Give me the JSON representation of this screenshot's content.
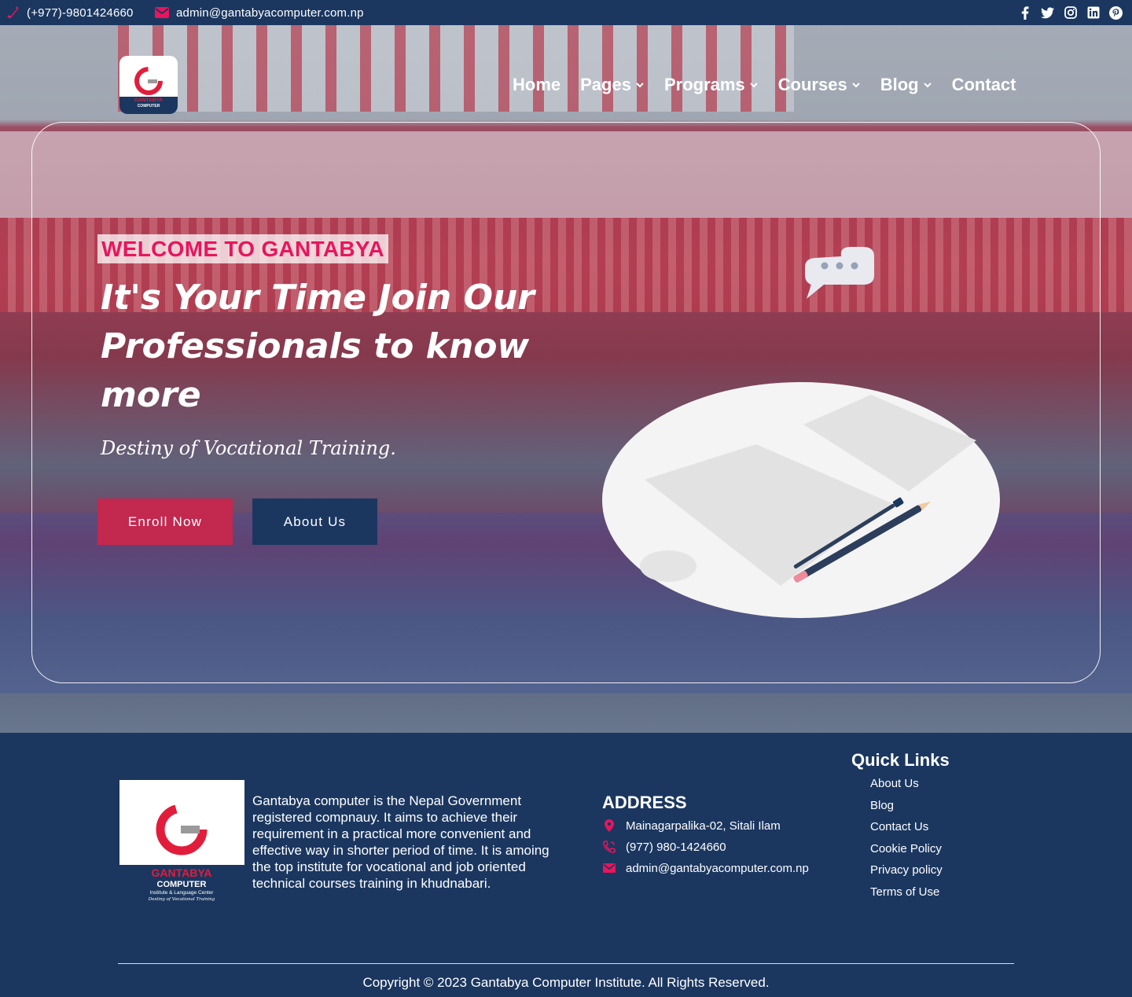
{
  "topbar": {
    "phone": "(+977)-9801424660",
    "email": "admin@gantabyacomputer.com.np",
    "social_icons": [
      "facebook-icon",
      "twitter-icon",
      "instagram-icon",
      "linkedin-icon",
      "pinterest-icon"
    ]
  },
  "brand": {
    "logo_title": "GANTABYA",
    "logo_subtitle": "COMPUTER",
    "logo_line": "Institute & Language Center",
    "logo_motto": "Destiny of Vocational Training"
  },
  "nav": {
    "items": [
      {
        "label": "Home",
        "has_dropdown": false
      },
      {
        "label": "Pages",
        "has_dropdown": true
      },
      {
        "label": "Programs",
        "has_dropdown": true
      },
      {
        "label": "Courses",
        "has_dropdown": true
      },
      {
        "label": "Blog",
        "has_dropdown": true
      },
      {
        "label": "Contact",
        "has_dropdown": false
      }
    ]
  },
  "hero": {
    "welcome": "WELCOME TO GANTABYA",
    "headline": "It's Your Time Join Our Professionals to know more",
    "tagline": "Destiny of Vocational Training.",
    "enroll_label": "Enroll Now",
    "about_label": "About Us"
  },
  "footer": {
    "about_text": "Gantabya computer is the Nepal Government registered compnauy. It aims to achieve their requirement in a practical more convenient and effective way in shorter period of time. It is amoing the top institute for vocational and job oriented technical courses training in khudnabari.",
    "address_title": "ADDRESS",
    "address": "Mainagarpalika-02, Sitali Ilam",
    "phone": "(977) 980-1424660",
    "email": "admin@gantabyacomputer.com.np",
    "quick_links_title": "Quick Links",
    "quick_links": [
      "About Us",
      "Blog",
      "Contact Us",
      "Cookie Policy",
      "Privacy policy",
      "Terms of Use"
    ],
    "copyright": "Copyright © 2023 Gantabya Computer Institute. All Rights Reserved."
  },
  "colors": {
    "navy": "#1b3760",
    "accent_pink": "#e8155d",
    "button_red": "#c3284f"
  }
}
